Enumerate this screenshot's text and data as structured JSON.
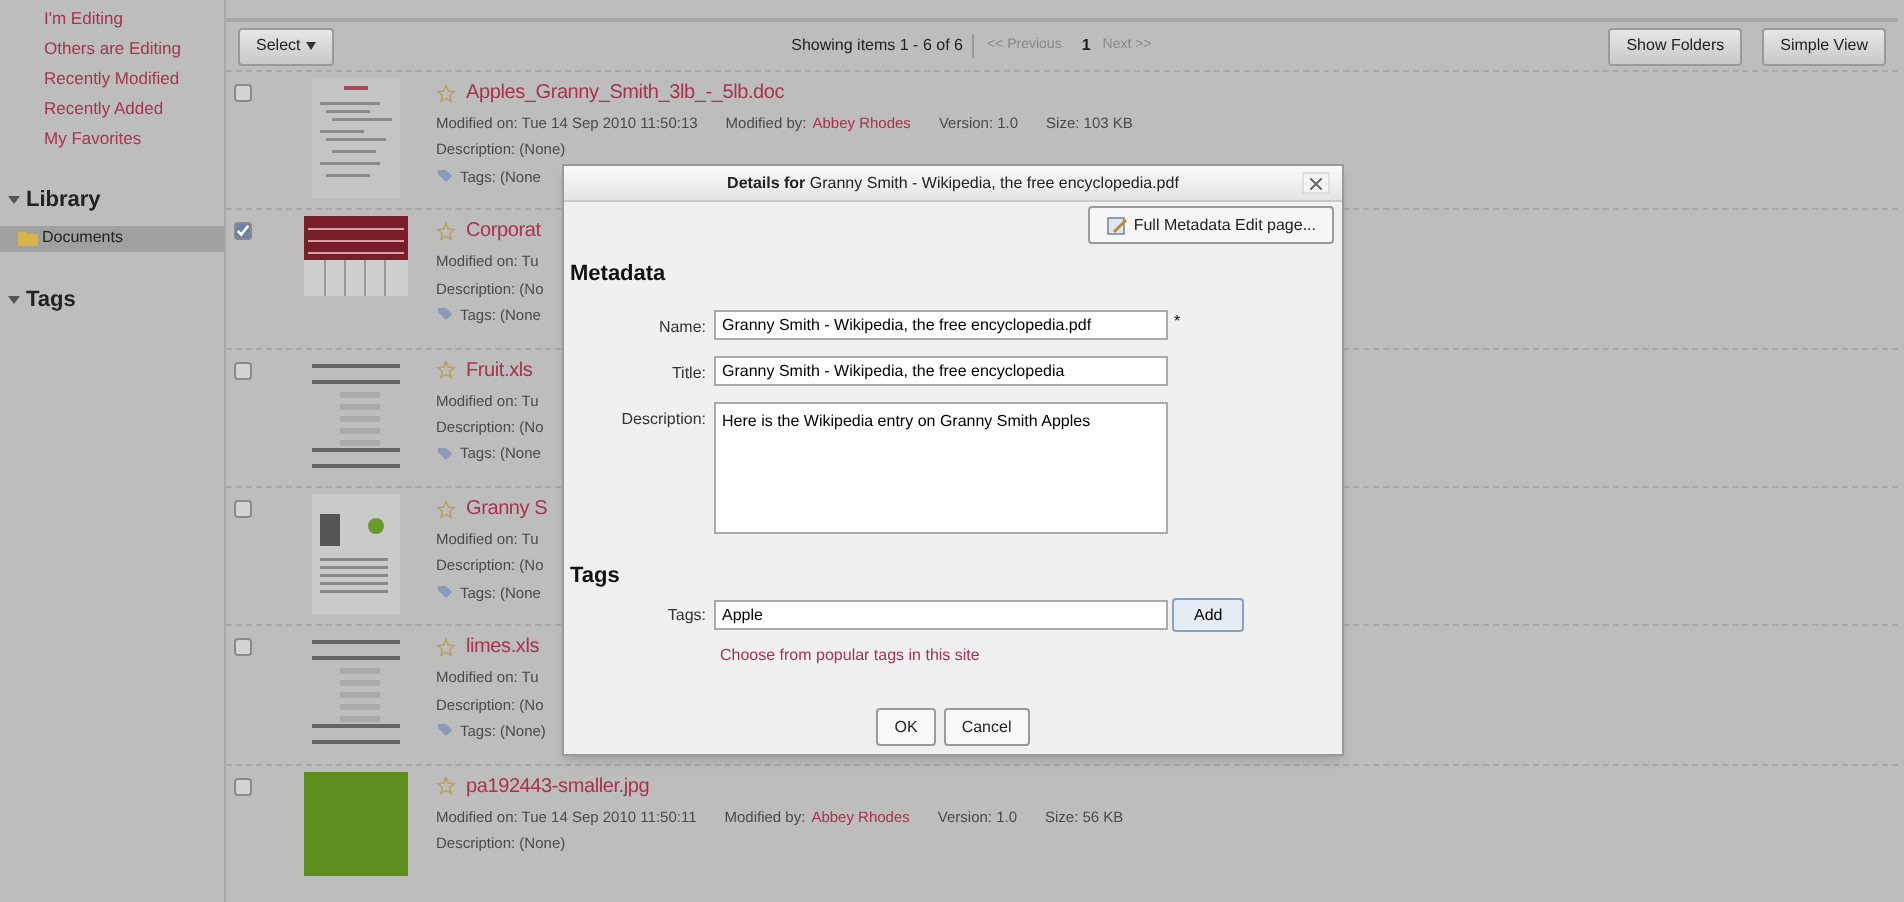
{
  "sidebar": {
    "links": [
      "I'm Editing",
      "Others are Editing",
      "Recently Modified",
      "Recently Added",
      "My Favorites"
    ],
    "sections": [
      {
        "title": "Library",
        "expanded": true,
        "items": [
          {
            "label": "Documents",
            "selected": true
          }
        ]
      },
      {
        "title": "Tags",
        "expanded": true
      }
    ]
  },
  "toolbar": {
    "select_button": "Select",
    "status": "Showing items 1 - 6 of 6",
    "previous": "<< Previous",
    "page": "1",
    "next": "Next >>",
    "buttons": [
      "Show Folders",
      "Simple View"
    ]
  },
  "rows": [
    {
      "checked": false,
      "kind": "document",
      "name": "Apples_Granny_Smith_3lb_-_5lb.doc",
      "modified": "Modified on: Tue 14 Sep 2010 11:50:13",
      "modified_by_label": "Modified by:",
      "modified_by": "Abbey Rhodes",
      "version": "Version: 1.0",
      "size": "Size: 103 KB",
      "description": "Description: (None)",
      "tags": "Tags: (None"
    },
    {
      "checked": true,
      "kind": "table",
      "name": "Corporat",
      "modified": "Modified on: Tu",
      "description": "Description: (No",
      "tags": "Tags: (None"
    },
    {
      "checked": false,
      "kind": "spreadsheet",
      "name": "Fruit.xls",
      "modified": "Modified on: Tu",
      "description": "Description: (No",
      "tags": "Tags: (None"
    },
    {
      "checked": false,
      "kind": "article",
      "name": "Granny S",
      "modified": "Modified on: Tu",
      "description": "Description: (No",
      "tags": "Tags: (None"
    },
    {
      "checked": false,
      "kind": "spreadsheet",
      "name": "limes.xls",
      "modified": "Modified on: Tu",
      "description": "Description: (No",
      "tags": "Tags: (None)"
    },
    {
      "checked": false,
      "kind": "photo",
      "name": "pa192443-smaller.jpg",
      "modified": "Modified on: Tue 14 Sep 2010 11:50:11",
      "modified_by_label": "Modified by:",
      "modified_by": "Abbey Rhodes",
      "version": "Version: 1.0",
      "size": "Size: 56 KB",
      "description": "Description: (None)"
    }
  ],
  "dialog": {
    "title": "**Details for** Granny Smith - Wikipedia, the free encyclopedia.pdf",
    "full_edit_button": "Full Metadata Edit page...",
    "metadata_heading": "Metadata",
    "fields": [
      {
        "kind": "input",
        "label": "Name:",
        "value": "Granny Smith - Wikipedia, the free encyclopedia.pdf",
        "required_mark": "*"
      },
      {
        "kind": "input",
        "label": "Title:",
        "value": "Granny Smith - Wikipedia, the free encyclopedia"
      },
      {
        "kind": "textarea",
        "label": "Description:",
        "value": "Here is the Wikipedia entry on Granny Smith Apples"
      }
    ],
    "tags_heading": "Tags",
    "tags_label": "Tags:",
    "tags_value": "Apple",
    "add_button": "Add",
    "popular_link": "Choose from popular tags in this site",
    "buttons": [
      "OK",
      "Cancel"
    ]
  }
}
